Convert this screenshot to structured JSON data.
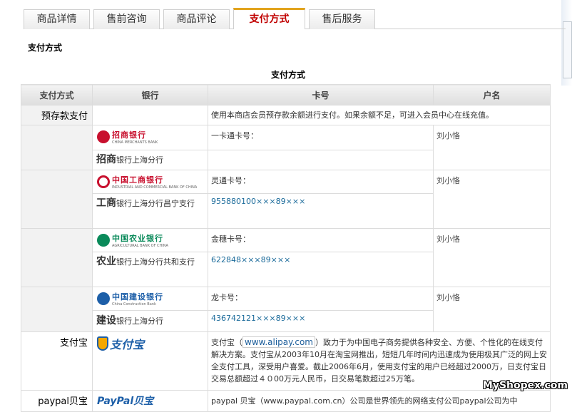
{
  "tabs": [
    "商品详情",
    "售前咨询",
    "商品评论",
    "支付方式",
    "售后服务"
  ],
  "active_tab": 3,
  "section_title": "支付方式",
  "table_title": "支付方式",
  "headers": {
    "method": "支付方式",
    "bank": "银行",
    "card": "卡号",
    "owner": "户名"
  },
  "prepay": {
    "label": "预存款支付",
    "text": "使用本商店会员预存款余额进行支付。如果余额不足，可进入会员中心在线充值。"
  },
  "banks": [
    {
      "logo_cn": "招商银行",
      "logo_en": "CHINA MERCHANTS BANK",
      "color": "#c8102e",
      "branch_bold": "招商",
      "branch_rest": "银行上海分行",
      "card_label": "一卡通卡号：",
      "card_no": "",
      "owner": "刘小恪"
    },
    {
      "logo_cn": "中国工商银行",
      "logo_en": "INDUSTRIAL AND COMMERCIAL BANK OF CHINA",
      "color": "#c8102e",
      "branch_bold": "工商",
      "branch_rest": "银行上海分行昌宁支行",
      "card_label": "灵通卡号：",
      "card_no": "955880100×××89×××",
      "owner": "刘小恪"
    },
    {
      "logo_cn": "中国农业银行",
      "logo_en": "AGRICULTURAL BANK OF CHINA",
      "color": "#0a8a5a",
      "branch_bold": "农业",
      "branch_rest": "银行上海分行共和支行",
      "card_label": "金穗卡号：",
      "card_no": "622848×××89×××",
      "owner": "刘小恪"
    },
    {
      "logo_cn": "中国建设银行",
      "logo_en": "China Construction Bank",
      "color": "#1d5fa8",
      "branch_bold": "建设",
      "branch_rest": "银行上海分行",
      "card_label": "龙卡号：",
      "card_no": "436742121×××89×××",
      "owner": "刘小恪"
    }
  ],
  "alipay": {
    "label": "支付宝",
    "logo": "支付宝",
    "desc_pre": "支付宝（",
    "link": "www.alipay.com",
    "desc_post": "）致力于为中国电子商务提供各种安全、方便、个性化的在线支付解决方案。支付宝从2003年10月在淘宝网推出，短短几年时间内迅速成为使用极其广泛的网上安全支付工具，深受用户喜爱。截止2006年6月，使用支付宝的用户已经超过2000万，日支付宝日交易总额超过４０00万元人民币，日交易笔数超过25万笔。"
  },
  "paypal": {
    "label": "paypal贝宝",
    "logo": "PayPal贝宝",
    "desc": "paypal 贝宝（www.paypal.com.cn）公司是世界领先的网络支付公司paypal公司为中"
  },
  "watermark": "MyShopex.com",
  "icons": {
    "tab_divider": "none"
  }
}
